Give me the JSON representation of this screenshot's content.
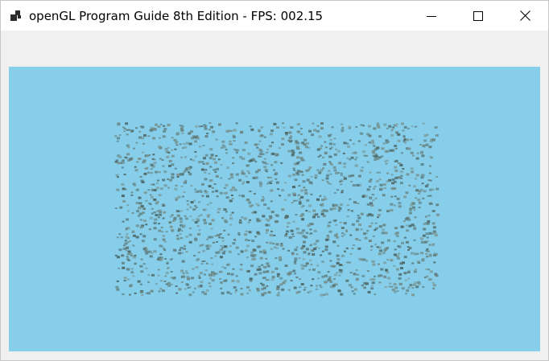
{
  "window": {
    "title": "openGL Program Guide 8th Edition - FPS: 002.15",
    "icon": "app-window-icon"
  },
  "caption_buttons": {
    "minimize_icon": "minimize-icon",
    "maximize_icon": "maximize-icon",
    "close_icon": "close-icon"
  },
  "viewport": {
    "clear_color": "#87ceeb",
    "particle_colors": [
      "#5f7f7f",
      "#6d8a88",
      "#4f6b6b",
      "#7a9694"
    ],
    "particle_count": 1800
  }
}
